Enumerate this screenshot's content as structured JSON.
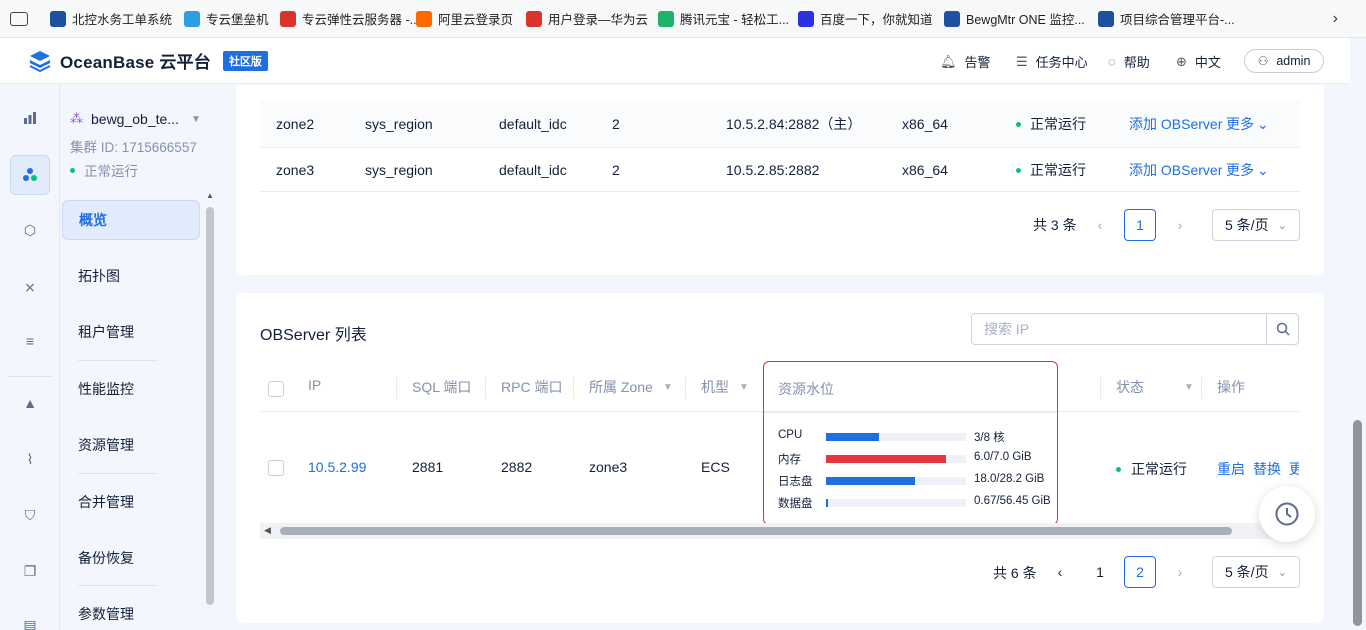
{
  "bookmarks": [
    {
      "label": "北控水务工单系统",
      "color": "#1e50a2"
    },
    {
      "label": "专云堡垒机",
      "color": "#2aa0e0"
    },
    {
      "label": "专云弹性云服务器 -...",
      "color": "#d9342b"
    },
    {
      "label": "阿里云登录页",
      "color": "#ff6a00"
    },
    {
      "label": "用户登录—华为云",
      "color": "#d9342b"
    },
    {
      "label": "腾讯元宝 - 轻松工...",
      "color": "#1fb36a"
    },
    {
      "label": "百度一下，你就知道",
      "color": "#2932e1"
    },
    {
      "label": "BewgMtr ONE 监控...",
      "color": "#1e50a2"
    },
    {
      "label": "项目综合管理平台-...",
      "color": "#1e50a2"
    }
  ],
  "header": {
    "logo_text": "OceanBase 云平台",
    "edition_badge": "社区版",
    "alerts": "告警",
    "tasks": "任务中心",
    "help": "帮助",
    "language": "中文",
    "user": "admin"
  },
  "cluster": {
    "name": "bewg_ob_te...",
    "id_text": "集群 ID: 1715666557",
    "status": "正常运行"
  },
  "nav": [
    "概览",
    "拓扑图",
    "租户管理",
    "性能监控",
    "资源管理",
    "合并管理",
    "备份恢复",
    "参数管理"
  ],
  "zones": {
    "rows": [
      {
        "zone": "zone2",
        "region": "sys_region",
        "idc": "default_idc",
        "count": "2",
        "root": "10.5.2.84:2882（主）",
        "arch": "x86_64",
        "status": "正常运行",
        "action_add": "添加 OBServer",
        "action_more": "更多"
      },
      {
        "zone": "zone3",
        "region": "sys_region",
        "idc": "default_idc",
        "count": "2",
        "root": "10.5.2.85:2882",
        "arch": "x86_64",
        "status": "正常运行",
        "action_add": "添加 OBServer",
        "action_more": "更多"
      }
    ],
    "pager": {
      "total": "共 3 条",
      "page": "1",
      "size": "5 条/页"
    }
  },
  "observers": {
    "title": "OBServer 列表",
    "search_placeholder": "搜索 IP",
    "columns": {
      "ip": "IP",
      "sql_port": "SQL 端口",
      "rpc_port": "RPC 端口",
      "zone": "所属 Zone",
      "type": "机型",
      "resource": "资源水位",
      "status": "状态",
      "ops": "操作"
    },
    "row": {
      "ip": "10.5.2.99",
      "sql_port": "2881",
      "rpc_port": "2882",
      "zone": "zone3",
      "type": "ECS",
      "status": "正常运行",
      "op_restart": "重启",
      "op_replace": "替换",
      "op_more": "更"
    },
    "resources": [
      {
        "label": "CPU",
        "value": "3/8 核",
        "ratio": 0.375,
        "color": "#1e6fe0"
      },
      {
        "label": "内存",
        "value": "6.0/7.0 GiB",
        "ratio": 0.857,
        "color": "#e8373c"
      },
      {
        "label": "日志盘",
        "value": "18.0/28.2 GiB",
        "ratio": 0.638,
        "color": "#1e6fe0"
      },
      {
        "label": "数据盘",
        "value": "0.67/56.45 GiB",
        "ratio": 0.012,
        "color": "#1e6fe0"
      }
    ],
    "pager": {
      "total": "共 6 条",
      "page1": "1",
      "page2": "2",
      "size": "5 条/页"
    }
  }
}
